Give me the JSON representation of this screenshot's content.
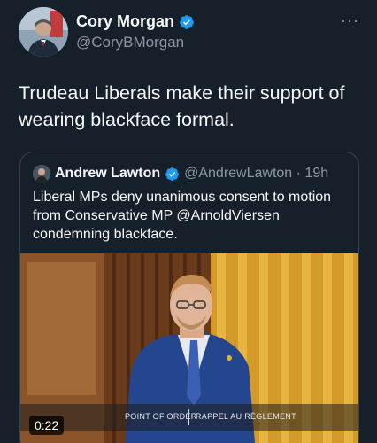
{
  "author": {
    "display_name": "Cory Morgan",
    "handle": "@CoryBMorgan",
    "verified_icon": "verified-badge-icon"
  },
  "menu": {
    "more_label": "···"
  },
  "tweet": {
    "text": "Trudeau Liberals make their support of wearing blackface formal."
  },
  "quoted": {
    "display_name": "Andrew Lawton",
    "handle_time": "@AndrewLawton · 19h",
    "text": "Liberal MPs deny unanimous consent to motion from Conservative MP @ArnoldViersen condemning blackface.",
    "media": {
      "lower_third_left": "POINT OF ORDER",
      "lower_third_right": "RAPPEL AU RÈGLEMENT",
      "duration": "0:22"
    }
  },
  "colors": {
    "background": "#15202b",
    "verified": "#1d9bf0",
    "secondary_text": "#8b98a5",
    "border": "#38444d"
  }
}
